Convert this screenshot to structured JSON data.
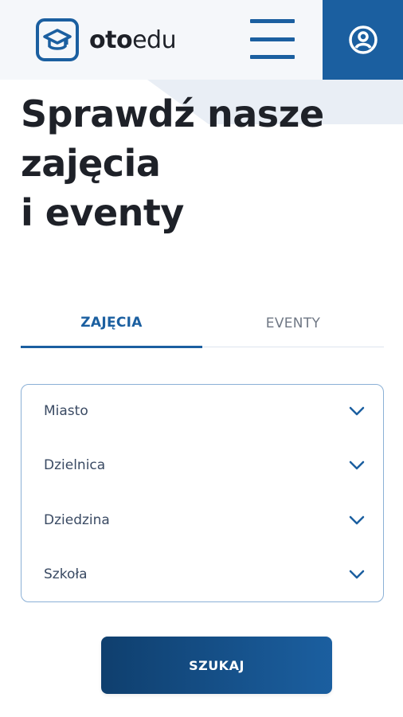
{
  "header": {
    "logo_bold": "oto",
    "logo_light": "edu",
    "menu_icon": "hamburger-menu-icon",
    "user_icon": "user-account-icon"
  },
  "title": {
    "line1": "Sprawdź nasze",
    "line2": "zajęcia",
    "line3": "i eventy"
  },
  "tabs": [
    {
      "label": "ZAJĘCIA",
      "active": true
    },
    {
      "label": "EVENTY",
      "active": false
    }
  ],
  "filters": [
    {
      "label": "Miasto",
      "icon": "chevron-down-icon"
    },
    {
      "label": "Dzielnica",
      "icon": "chevron-down-icon"
    },
    {
      "label": "Dziedzina",
      "icon": "chevron-down-icon"
    },
    {
      "label": "Szkoła",
      "icon": "chevron-down-icon"
    }
  ],
  "search_button": {
    "label": "SZUKAJ"
  },
  "colors": {
    "primary": "#1b5fa0",
    "primary_dark": "#0f3f6e",
    "text": "#1e2128",
    "muted": "#6f7784",
    "header_bg": "#f5f7fa"
  }
}
